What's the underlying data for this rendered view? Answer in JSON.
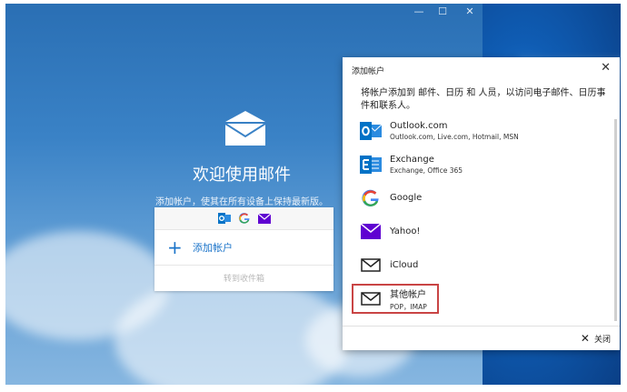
{
  "window": {
    "minimize_glyph": "—",
    "maximize_glyph": "☐",
    "close_glyph": "✕"
  },
  "welcome": {
    "title": "欢迎使用邮件",
    "subtitle": "添加帐户，使其在所有设备上保持最新版。",
    "add_account_label": "添加帐户",
    "goto_inbox_label": "转到收件箱",
    "plus_glyph": "+"
  },
  "dialog": {
    "title": "添加帐户",
    "close_glyph": "✕",
    "description": "将帐户添加到 邮件、日历 和 人员，以访问电子邮件、日历事件和联系人。",
    "accounts": [
      {
        "name": "Outlook.com",
        "detail": "Outlook.com, Live.com, Hotmail, MSN",
        "icon": "outlook-icon"
      },
      {
        "name": "Exchange",
        "detail": "Exchange, Office 365",
        "icon": "exchange-icon"
      },
      {
        "name": "Google",
        "detail": "",
        "icon": "google-icon"
      },
      {
        "name": "Yahoo!",
        "detail": "",
        "icon": "yahoo-icon"
      },
      {
        "name": "iCloud",
        "detail": "",
        "icon": "mail-icon"
      },
      {
        "name": "其他帐户",
        "detail": "POP，IMAP",
        "icon": "mail-icon"
      }
    ],
    "footer_close_label": "关闭",
    "footer_close_glyph": "✕"
  },
  "colors": {
    "accent": "#1a73c9",
    "outlook": "#0072c6",
    "yahoo": "#5f01d1",
    "highlight": "#c94444"
  }
}
